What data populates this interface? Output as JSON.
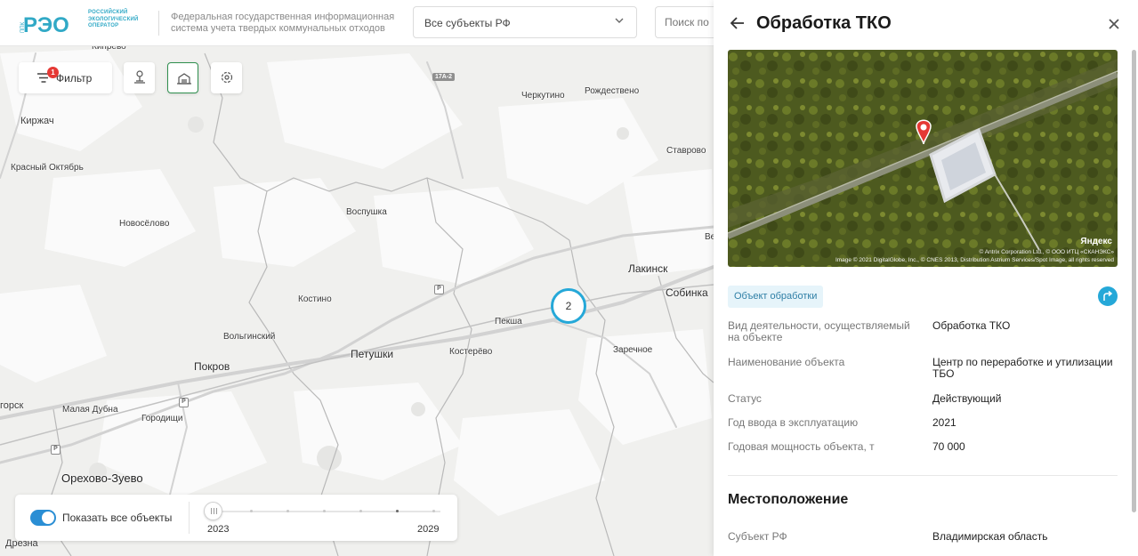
{
  "header": {
    "logo_text": "РЭО",
    "logo_vertical": "ППК",
    "logo_org": [
      "РОССИЙСКИЙ",
      "ЭКОЛОГИЧЕСКИЙ",
      "ОПЕРАТОР"
    ],
    "system_title": "Федеральная государственная информационная система учета твердых коммунальных отходов",
    "region_select": "Все субъекты РФ",
    "search_placeholder": "Поиск по"
  },
  "toolbar": {
    "filter_label": "Фильтр",
    "filter_count": "1",
    "buttons": [
      "pin-icon",
      "recycling-plant-icon",
      "settings-object-icon"
    ]
  },
  "map": {
    "places": {
      "kirzhach": "Киржач",
      "krasny": "Красный Октябрь",
      "novoselovo": "Новосёлово",
      "vospushka": "Воспушка",
      "kostino": "Костино",
      "volginsky": "Вольгинский",
      "pokrov": "Покров",
      "petushki": "Петушки",
      "kosterevo": "Костерёво",
      "peksha": "Пекша",
      "lakinsk": "Лакинск",
      "sobinka": "Собинка",
      "zarechnoe": "Заречное",
      "cherkutino": "Черкутино",
      "rozhdestveno": "Рождествено",
      "stavrovo": "Ставрово",
      "kiprevo": "Кипрево",
      "malaya_dubna": "Малая Дубна",
      "gorodishchi": "Городищи",
      "orekhovo": "Орехово-Зуево",
      "drezna": "Дрезна",
      "gorsk": "горск",
      "ve": "Ве"
    },
    "road_label": "17А-2",
    "cluster_count": "2"
  },
  "timeline": {
    "toggle_label": "Показать все объекты",
    "toggle_on": true,
    "year_start": "2023",
    "year_end": "2029"
  },
  "panel": {
    "title": "Обработка ТКО",
    "image_brand": "Яндекс",
    "image_credit_1": "© Antrix Corporation Ltd., © ООО ИТЦ «СКАНЭКС»",
    "image_credit_2": "Image © 2021 DigitalGlobe, Inc., © CNES 2013, Distribution Astrium Services/Spot Image, all rights reserved",
    "object_tag": "Объект обработки",
    "fields": [
      {
        "key": "Вид деятельности, осуществляемый на объекте",
        "value": "Обработка ТКО"
      },
      {
        "key": "Наименование объекта",
        "value": "Центр по переработке и утилизации ТБО"
      },
      {
        "key": "Статус",
        "value": "Действующий"
      },
      {
        "key": "Год ввода в эксплуатацию",
        "value": "2021"
      },
      {
        "key": "Годовая мощность объекта, т",
        "value": "70 000"
      }
    ],
    "location_title": "Местоположение",
    "location_fields": [
      {
        "key": "Субъект РФ",
        "value": "Владимирская область"
      }
    ]
  },
  "colors": {
    "accent_blue": "#25a8d8",
    "toggle_blue": "#2a8ed4",
    "active_green": "#2f8f4e",
    "badge_red": "#e53935",
    "logo_teal": "#31a9c6"
  }
}
